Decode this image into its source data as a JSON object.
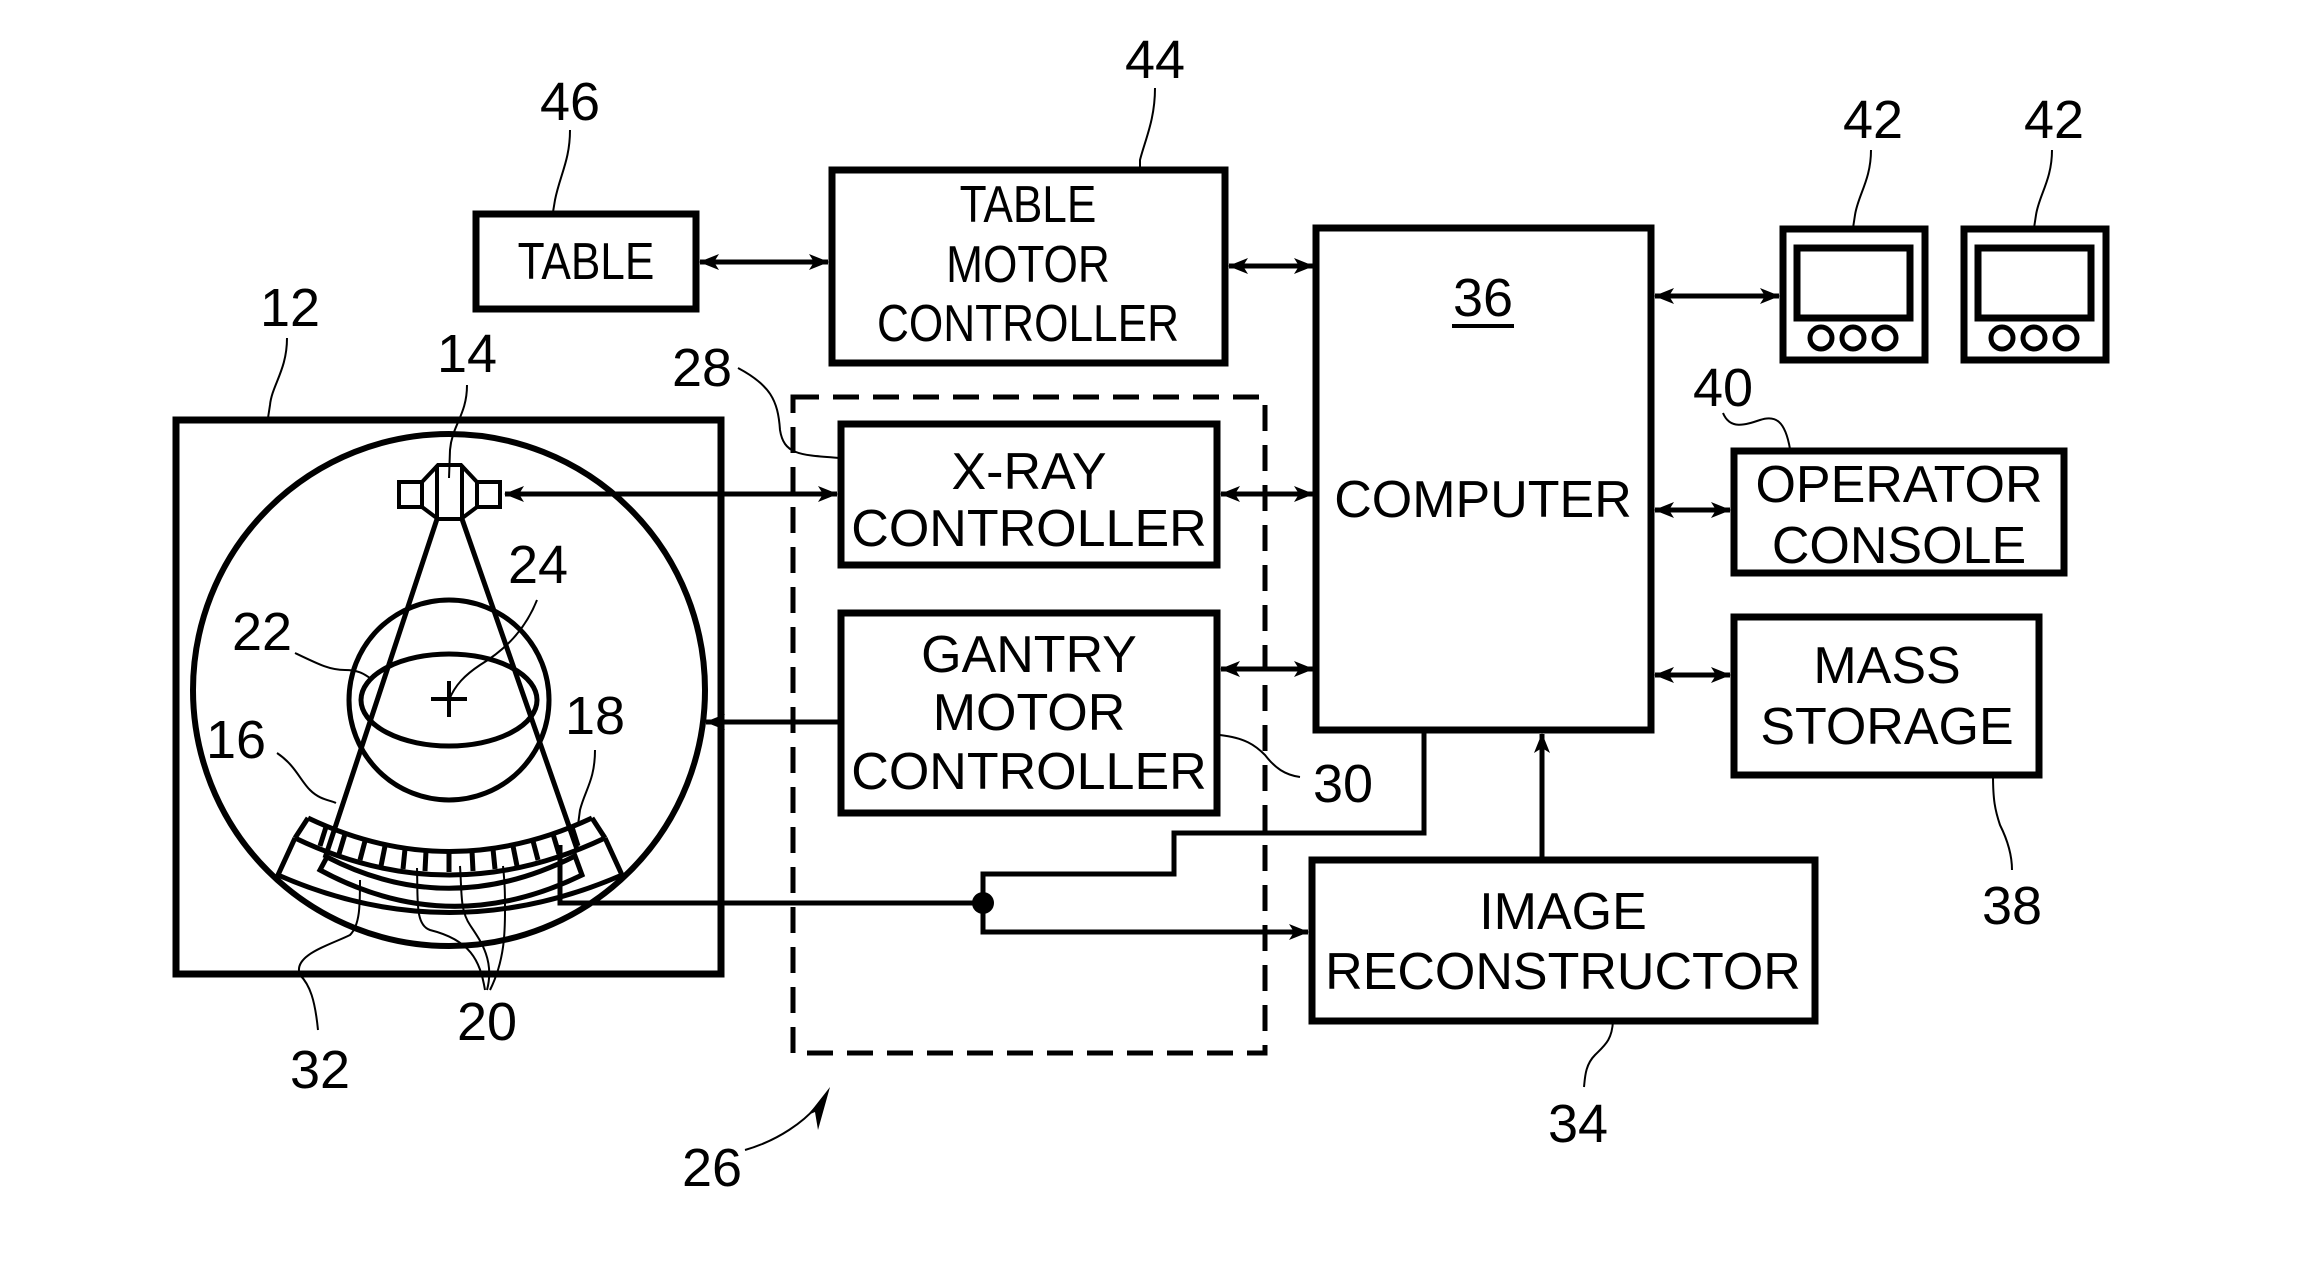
{
  "figure": {
    "blocks": {
      "table": {
        "label": "TABLE",
        "ref": "46"
      },
      "table_motor_controller": {
        "lines": [
          "TABLE",
          "MOTOR",
          "CONTROLLER"
        ],
        "ref": "44"
      },
      "computer": {
        "label": "COMPUTER",
        "ref": "36"
      },
      "xray_controller": {
        "lines": [
          "X-RAY",
          "CONTROLLER"
        ],
        "ref": "28"
      },
      "gantry_motor_controller": {
        "lines": [
          "GANTRY",
          "MOTOR",
          "CONTROLLER"
        ],
        "ref": "30"
      },
      "operator_console": {
        "lines": [
          "OPERATOR",
          "CONSOLE"
        ],
        "ref": "40"
      },
      "mass_storage": {
        "lines": [
          "MASS",
          "STORAGE"
        ],
        "ref": "38"
      },
      "image_reconstructor": {
        "lines": [
          "IMAGE",
          "RECONSTRUCTOR"
        ],
        "ref": "34"
      },
      "display_1": {
        "ref": "42"
      },
      "display_2": {
        "ref": "42"
      }
    },
    "gantry_refs": {
      "gantry": "12",
      "xray_source": "14",
      "xray_beam": "16",
      "detector_array": "18",
      "detector_elements": "20",
      "patient": "22",
      "center_of_rotation": "24",
      "data_acquisition_system": "32"
    },
    "control_mechanism_ref": "26"
  }
}
